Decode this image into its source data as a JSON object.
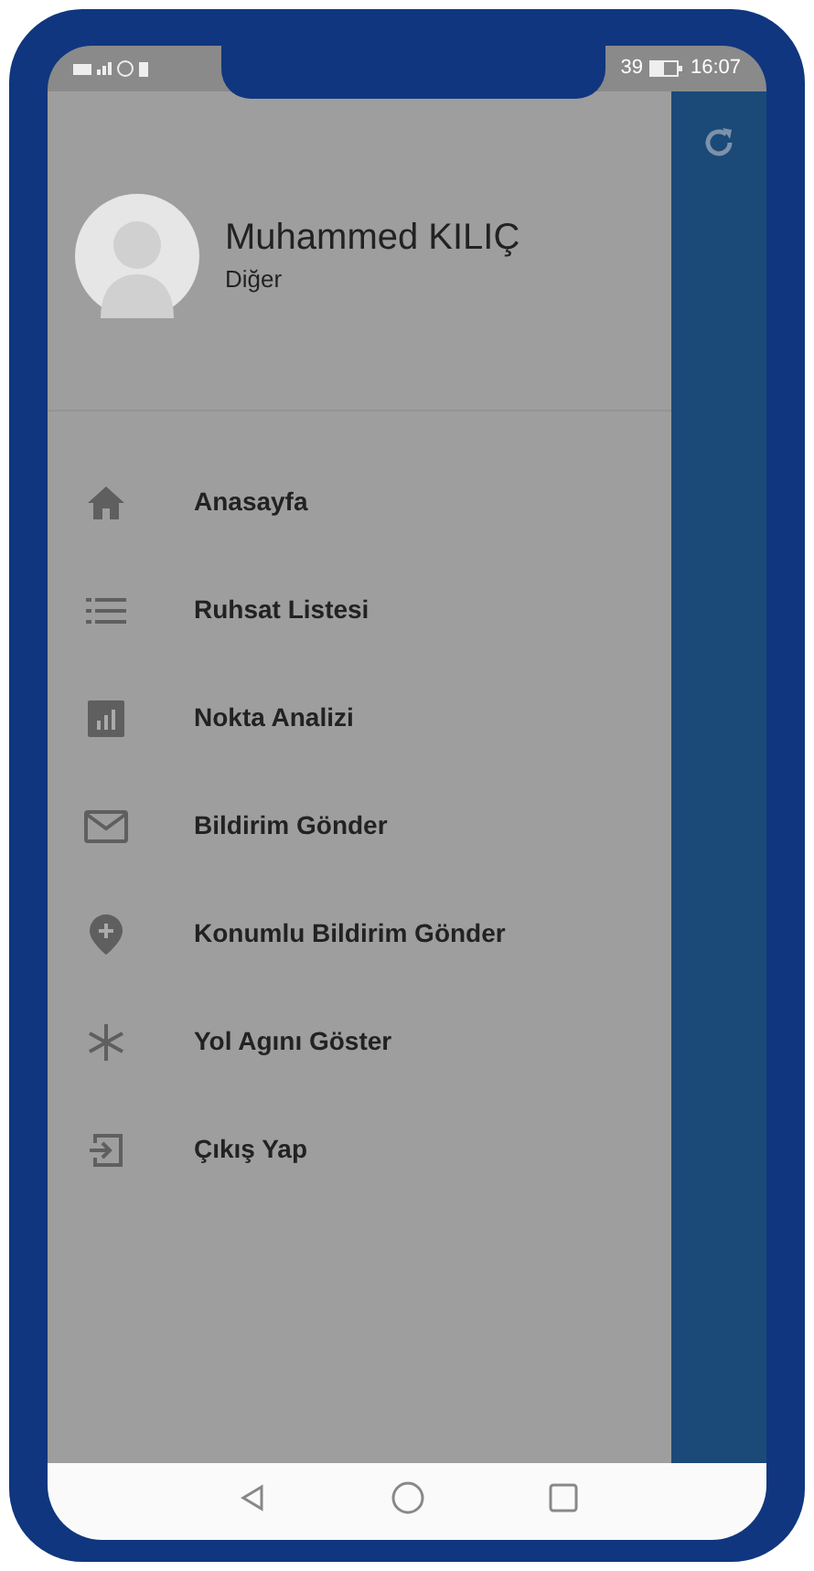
{
  "status_bar": {
    "signal_text": "39",
    "time": "16:07"
  },
  "profile": {
    "name": "Muhammed KILIÇ",
    "role": "Diğer"
  },
  "menu": [
    {
      "label": "Anasayfa",
      "kind": "home"
    },
    {
      "label": "Ruhsat Listesi",
      "kind": "list"
    },
    {
      "label": "Nokta Analizi",
      "kind": "chart"
    },
    {
      "label": "Bildirim Gönder",
      "kind": "mail"
    },
    {
      "label": "Konumlu Bildirim Gönder",
      "kind": "pin"
    },
    {
      "label": "Yol Agını Göster",
      "kind": "snow"
    },
    {
      "label": "Çıkış Yap",
      "kind": "exit"
    }
  ]
}
